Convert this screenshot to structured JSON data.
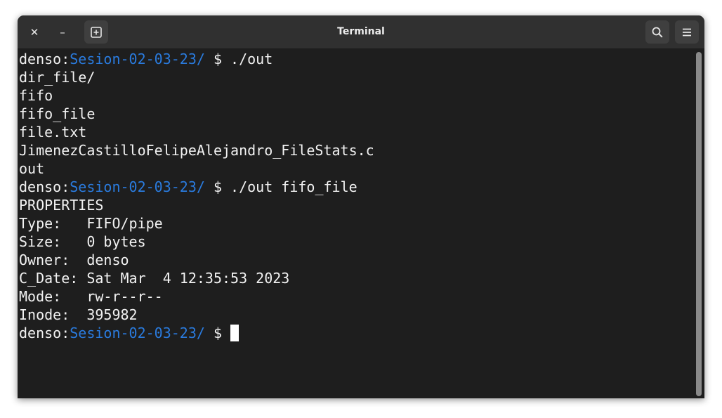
{
  "window": {
    "title": "Terminal",
    "close_glyph": "✕",
    "minimize_glyph": "–",
    "icons": {
      "close": "close-icon",
      "minimize": "minimize-icon",
      "new_tab": "new-tab-icon",
      "search": "search-icon",
      "menu": "hamburger-menu-icon"
    }
  },
  "colors": {
    "background": "#1e1e1e",
    "foreground": "#f2f2f2",
    "prompt_path": "#2a7bde",
    "titlebar": "#303030"
  },
  "terminal": {
    "prompt_user": "denso",
    "prompt_sep": ":",
    "prompt_path": "Sesion-02-03-23/",
    "prompt_symbol": " $ ",
    "lines": [
      {
        "type": "prompt",
        "command": "./out"
      },
      {
        "type": "output",
        "text": "dir_file/"
      },
      {
        "type": "output",
        "text": "fifo"
      },
      {
        "type": "output",
        "text": "fifo_file"
      },
      {
        "type": "output",
        "text": "file.txt"
      },
      {
        "type": "output",
        "text": "JimenezCastilloFelipeAlejandro_FileStats.c"
      },
      {
        "type": "output",
        "text": "out"
      },
      {
        "type": "prompt",
        "command": "./out fifo_file"
      },
      {
        "type": "output",
        "text": "PROPERTIES"
      },
      {
        "type": "output",
        "text": "Type:   FIFO/pipe"
      },
      {
        "type": "output",
        "text": "Size:   0 bytes"
      },
      {
        "type": "output",
        "text": "Owner:  denso"
      },
      {
        "type": "output",
        "text": "C_Date: Sat Mar  4 12:35:53 2023"
      },
      {
        "type": "output",
        "text": "Mode:   rw-r--r--"
      },
      {
        "type": "output",
        "text": "Inode:  395982"
      },
      {
        "type": "prompt",
        "command": "",
        "active": true
      }
    ]
  }
}
